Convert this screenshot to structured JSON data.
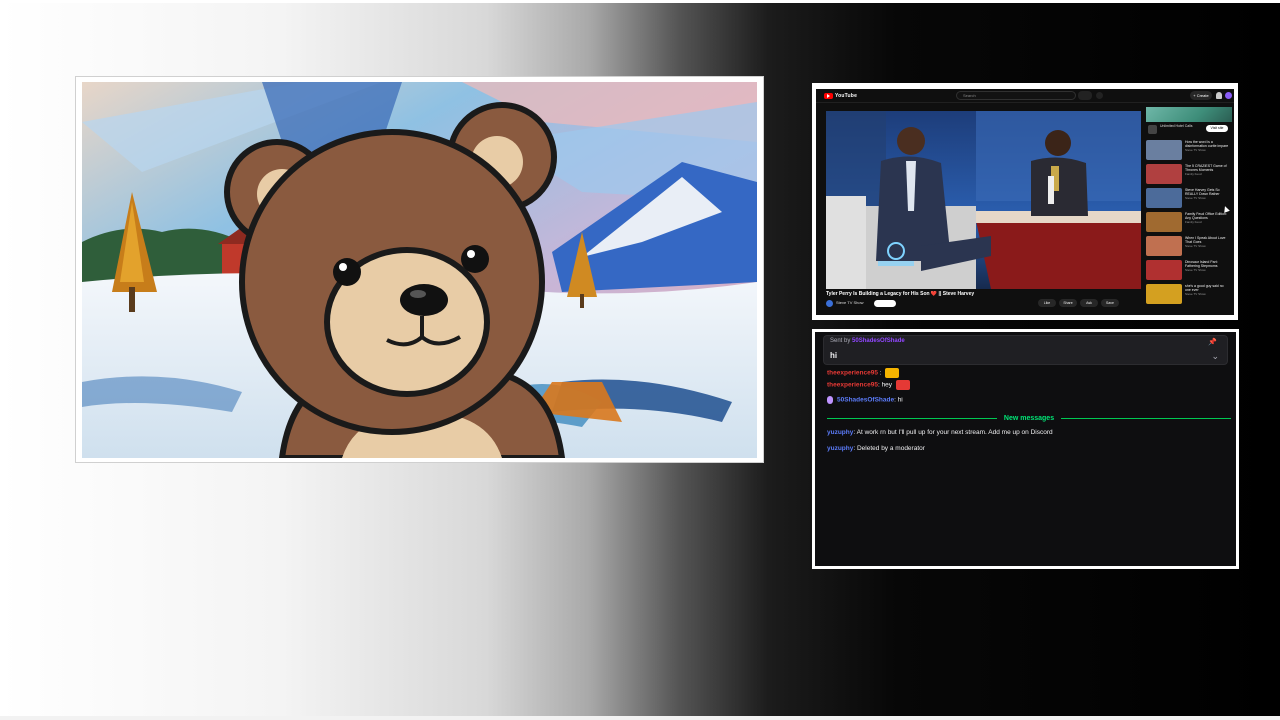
{
  "colors": {
    "chat_bg": "#0e0e10",
    "new_messages_green": "#00e676",
    "username_purple": "#5c7cfa",
    "username_red": "#e53935",
    "youtube_red": "#ff0000"
  },
  "webcam": {
    "description_icon": "bear-avatar"
  },
  "youtube": {
    "logo_text": "YouTube",
    "search_placeholder": "Search",
    "create_label": "+ Create",
    "video_title": "Tyler Perry Is Building a Legacy for His Son ❤️ || Steve Harvey",
    "channel_name": "Steve TV Show",
    "ad_title": "Unlimited Hotel Calls",
    "ad_button": "Visit site",
    "actions": [
      "Like",
      "Share",
      "Ask",
      "Save"
    ],
    "recommendations": [
      {
        "title": "How the word is a disinformation ourite impare",
        "meta": "Steve TV Show",
        "color": "#6a7fa0"
      },
      {
        "title": "The 5 CRAZIEST Game of Thrones Moments",
        "meta": "Family Feud",
        "color": "#b04040"
      },
      {
        "title": "Steve Harvey Gets So REALLY Down Rather",
        "meta": "Steve TV Show",
        "color": "#4c6b9a"
      },
      {
        "title": "Family Feud Office Edition: Any Questions",
        "meta": "Family Feud",
        "color": "#a06a30"
      },
      {
        "title": "When I Speak About Love That Goes",
        "meta": "Steve TV Show",
        "color": "#c07050"
      },
      {
        "title": "Dinosaur Island Part: Fathering Stepmoms",
        "meta": "Steve TV Show",
        "color": "#b03030"
      },
      {
        "title": "she's a good guy said no one ever",
        "meta": "Steve TV Show",
        "color": "#d4a020"
      }
    ]
  },
  "chat": {
    "pinned_by_label": "Sent by",
    "pinned_user": "50ShadesOfShade",
    "pinned_message": "hi",
    "messages": [
      {
        "user": "theexperience95",
        "text": ": hey",
        "user_color": "#e53935"
      },
      {
        "user": "50ShadesOfShade",
        "text": ": hi",
        "user_color": "#5c7cfa"
      },
      {
        "user": "yuzuphy",
        "text": ": At work rn but I'll pull up for your next stream. Add me up on Discord",
        "user_color": "#5c7cfa"
      },
      {
        "user": "yuzuphy",
        "text": ": Deleted by a moderator",
        "user_color": "#5c7cfa"
      }
    ],
    "new_messages_label": "New messages"
  }
}
